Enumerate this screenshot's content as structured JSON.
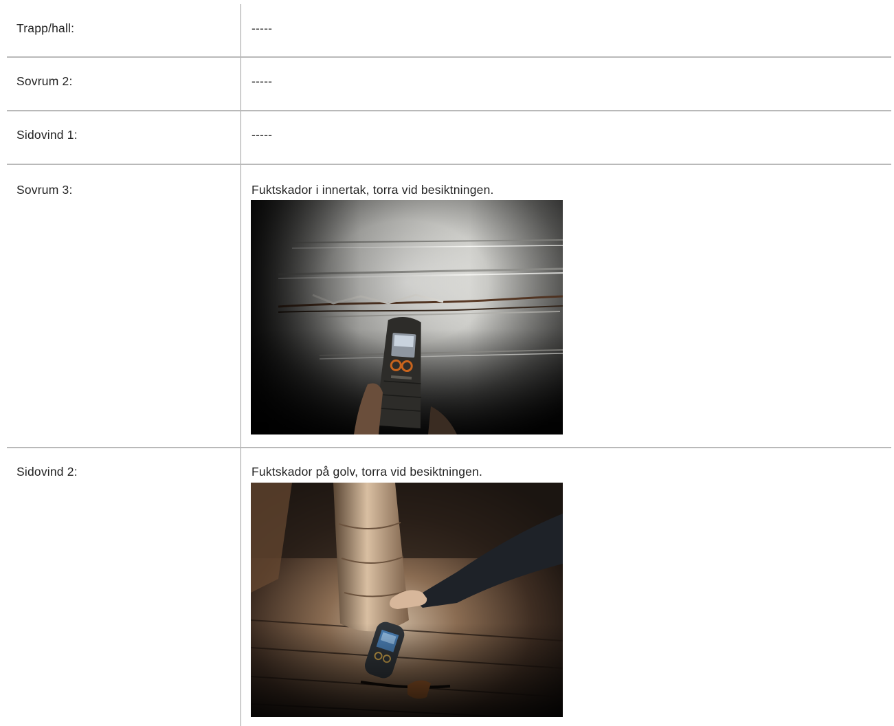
{
  "rows": [
    {
      "label": "Trapp/hall:",
      "value": "-----"
    },
    {
      "label": "Sovrum 2:",
      "value": "-----"
    },
    {
      "label": "Sidovind 1:",
      "value": "-----"
    },
    {
      "label": "Sovrum 3:",
      "value": "Fuktskador i innertak, torra vid besiktningen.",
      "photo": "moisture-meter-on-ceiling-photo"
    },
    {
      "label": "Sidovind 2:",
      "value": "Fuktskador på golv, torra vid besiktningen.",
      "photo": "moisture-meter-on-floor-photo"
    }
  ],
  "colors": {
    "text": "#222222",
    "divider": "#b9b9b9",
    "column_divider": "#9a9a9a"
  }
}
